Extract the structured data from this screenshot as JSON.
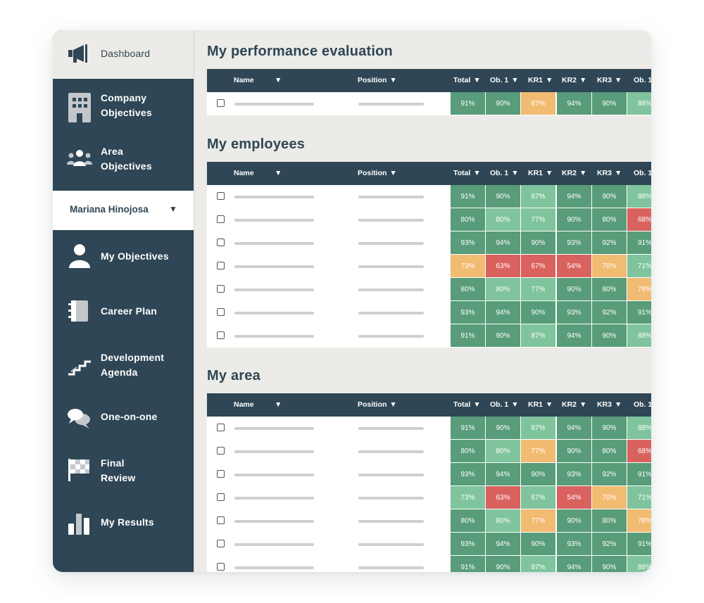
{
  "sidebar": {
    "dashboard": "Dashboard",
    "company_objectives": "Company\nObjectives",
    "area_objectives": "Area\nObjectives",
    "user_name": "Mariana Hinojosa",
    "user_caret": "▼",
    "my_objectives": "My Objectives",
    "career_plan": "Career Plan",
    "development_agenda": "Development\nAgenda",
    "one_on_one": "One-on-one",
    "final_review": "Final\nReview",
    "my_results": "My Results"
  },
  "columns": [
    "Name",
    "Position",
    "Total",
    "Ob. 1",
    "KR1",
    "KR2",
    "KR3",
    "Ob. 1"
  ],
  "sort_glyph": "▼",
  "status_colors": {
    "g": "#589c79",
    "l": "#7fc49d",
    "y": "#f2bb72",
    "r": "#d9625f"
  },
  "sections": [
    {
      "title": "My performance evaluation",
      "rows": [
        [
          [
            "91%",
            "g"
          ],
          [
            "90%",
            "g"
          ],
          [
            "87%",
            "y"
          ],
          [
            "94%",
            "g"
          ],
          [
            "90%",
            "g"
          ],
          [
            "88%",
            "l"
          ]
        ]
      ]
    },
    {
      "title": "My employees",
      "rows": [
        [
          [
            "91%",
            "g"
          ],
          [
            "90%",
            "g"
          ],
          [
            "87%",
            "l"
          ],
          [
            "94%",
            "g"
          ],
          [
            "90%",
            "g"
          ],
          [
            "88%",
            "l"
          ]
        ],
        [
          [
            "80%",
            "g"
          ],
          [
            "80%",
            "l"
          ],
          [
            "77%",
            "l"
          ],
          [
            "90%",
            "g"
          ],
          [
            "80%",
            "g"
          ],
          [
            "68%",
            "r"
          ]
        ],
        [
          [
            "93%",
            "g"
          ],
          [
            "94%",
            "g"
          ],
          [
            "90%",
            "g"
          ],
          [
            "93%",
            "g"
          ],
          [
            "92%",
            "g"
          ],
          [
            "91%",
            "g"
          ]
        ],
        [
          [
            "73%",
            "y"
          ],
          [
            "63%",
            "r"
          ],
          [
            "67%",
            "r"
          ],
          [
            "54%",
            "r"
          ],
          [
            "70%",
            "y"
          ],
          [
            "71%",
            "l"
          ]
        ],
        [
          [
            "80%",
            "g"
          ],
          [
            "80%",
            "l"
          ],
          [
            "77%",
            "l"
          ],
          [
            "90%",
            "g"
          ],
          [
            "80%",
            "g"
          ],
          [
            "78%",
            "y"
          ]
        ],
        [
          [
            "93%",
            "g"
          ],
          [
            "94%",
            "g"
          ],
          [
            "90%",
            "g"
          ],
          [
            "93%",
            "g"
          ],
          [
            "92%",
            "g"
          ],
          [
            "91%",
            "g"
          ]
        ],
        [
          [
            "91%",
            "g"
          ],
          [
            "90%",
            "g"
          ],
          [
            "87%",
            "l"
          ],
          [
            "94%",
            "g"
          ],
          [
            "90%",
            "g"
          ],
          [
            "88%",
            "l"
          ]
        ]
      ]
    },
    {
      "title": "My area",
      "rows": [
        [
          [
            "91%",
            "g"
          ],
          [
            "90%",
            "g"
          ],
          [
            "87%",
            "l"
          ],
          [
            "94%",
            "g"
          ],
          [
            "90%",
            "g"
          ],
          [
            "88%",
            "l"
          ]
        ],
        [
          [
            "80%",
            "g"
          ],
          [
            "80%",
            "l"
          ],
          [
            "77%",
            "y"
          ],
          [
            "90%",
            "g"
          ],
          [
            "80%",
            "g"
          ],
          [
            "68%",
            "r"
          ]
        ],
        [
          [
            "93%",
            "g"
          ],
          [
            "94%",
            "g"
          ],
          [
            "90%",
            "g"
          ],
          [
            "93%",
            "g"
          ],
          [
            "92%",
            "g"
          ],
          [
            "91%",
            "g"
          ]
        ],
        [
          [
            "73%",
            "l"
          ],
          [
            "63%",
            "r"
          ],
          [
            "67%",
            "l"
          ],
          [
            "54%",
            "r"
          ],
          [
            "70%",
            "y"
          ],
          [
            "71%",
            "l"
          ]
        ],
        [
          [
            "80%",
            "g"
          ],
          [
            "80%",
            "l"
          ],
          [
            "77%",
            "y"
          ],
          [
            "90%",
            "g"
          ],
          [
            "80%",
            "g"
          ],
          [
            "78%",
            "y"
          ]
        ],
        [
          [
            "93%",
            "g"
          ],
          [
            "94%",
            "g"
          ],
          [
            "90%",
            "g"
          ],
          [
            "93%",
            "g"
          ],
          [
            "92%",
            "g"
          ],
          [
            "91%",
            "g"
          ]
        ],
        [
          [
            "91%",
            "g"
          ],
          [
            "90%",
            "g"
          ],
          [
            "87%",
            "l"
          ],
          [
            "94%",
            "g"
          ],
          [
            "90%",
            "g"
          ],
          [
            "88%",
            "l"
          ]
        ]
      ]
    }
  ]
}
